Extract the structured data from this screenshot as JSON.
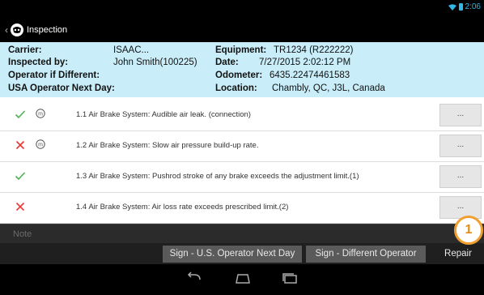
{
  "statusbar": {
    "time": "2:06"
  },
  "actionbar": {
    "title": "Inspection"
  },
  "info": {
    "carrier_label": "Carrier:",
    "carrier_value": "ISAAC...",
    "inspected_by_label": "Inspected by:",
    "inspected_by_value": "John Smith(100225)",
    "operator_diff_label": "Operator if Different:",
    "usa_operator_label": "USA Operator Next Day:",
    "equipment_label": "Equipment:",
    "equipment_value": "TR1234 (R222222)",
    "date_label": "Date:",
    "date_value": "7/27/2015 2:02:12 PM",
    "odometer_label": "Odometer:",
    "odometer_value": "6435.22474461583",
    "location_label": "Location:",
    "location_value": "Chambly, QC, J3L, Canada"
  },
  "items": [
    {
      "status": "ok",
      "major": true,
      "text": "1.1 Air Brake System: Audible air leak. (connection)",
      "more": "..."
    },
    {
      "status": "defect",
      "major": true,
      "text": "1.2 Air Brake System: Slow air pressure build-up rate.",
      "more": "..."
    },
    {
      "status": "ok",
      "major": false,
      "text": "1.3 Air Brake System: Pushrod stroke of any brake exceeds the adjustment limit.(1)",
      "more": "..."
    },
    {
      "status": "defect",
      "major": false,
      "text": "1.4 Air Brake System: Air loss rate exceeds prescribed limit.(2)",
      "more": "..."
    }
  ],
  "note": {
    "placeholder": "Note"
  },
  "buttons": {
    "sign_next_day": "Sign - U.S. Operator Next Day",
    "sign_different": "Sign - Different Operator",
    "repair": "Repair"
  },
  "badge": "1",
  "colors": {
    "ok": "#4caf50",
    "defect": "#e53935",
    "info_bg": "#c9eefa",
    "accent": "#33b5e5",
    "badge": "#f0a030"
  }
}
